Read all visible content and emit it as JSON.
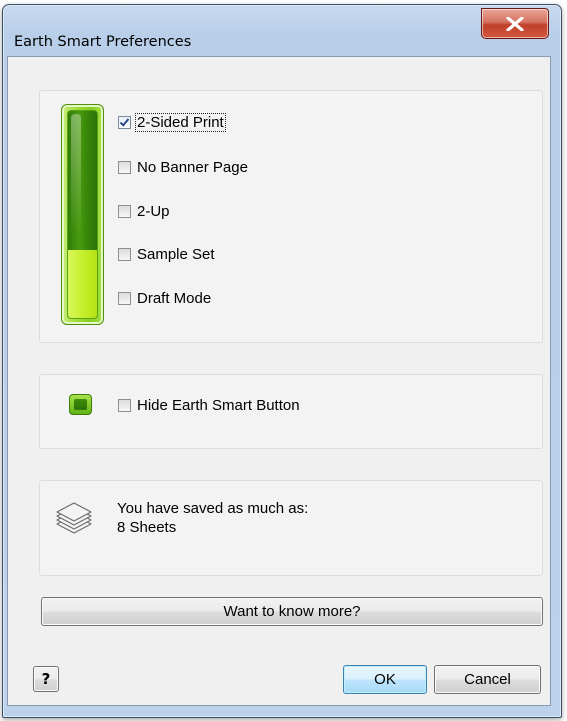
{
  "window": {
    "title": "Earth Smart Preferences"
  },
  "options": {
    "items": [
      {
        "label": "2-Sided Print",
        "checked": true
      },
      {
        "label": "No Banner Page",
        "checked": false
      },
      {
        "label": "2-Up",
        "checked": false
      },
      {
        "label": "Sample Set",
        "checked": false
      },
      {
        "label": "Draft Mode",
        "checked": false
      }
    ],
    "savings_meter_level": 0.33
  },
  "button_option": {
    "label": "Hide Earth Smart Button",
    "checked": false
  },
  "savings": {
    "line1": "You have saved as much as:",
    "line2": "8 Sheets",
    "icon": "paper-stack-icon"
  },
  "buttons": {
    "know_more": "Want to know more?",
    "help": "?",
    "ok": "OK",
    "cancel": "Cancel"
  },
  "colors": {
    "meter_green": "#3a8a0a",
    "meter_fill": "#c6ef2c",
    "close_red": "#c0402a"
  }
}
